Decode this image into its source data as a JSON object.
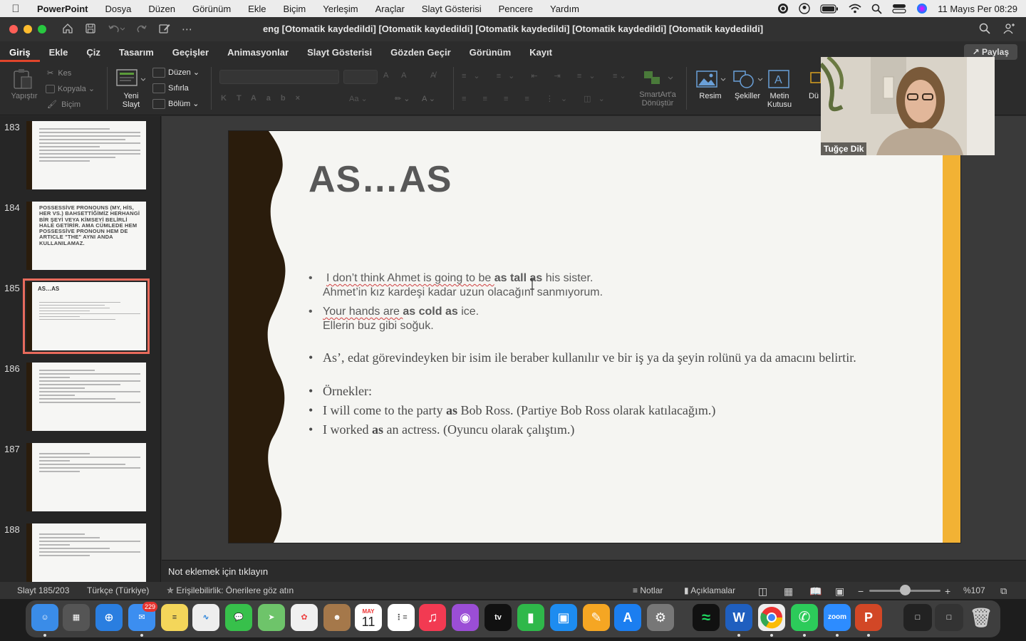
{
  "menubar": {
    "app_name": "PowerPoint",
    "items": [
      "Dosya",
      "Düzen",
      "Görünüm",
      "Ekle",
      "Biçim",
      "Yerleşim",
      "Araçlar",
      "Slayt Gösterisi",
      "Pencere",
      "Yardım"
    ],
    "clock": "11 Mayıs Per  08:29"
  },
  "window": {
    "title": "eng [Otomatik kaydedildi] [Otomatik kaydedildi] [Otomatik kaydedildi] [Otomatik kaydedildi] [Otomatik kaydedildi]"
  },
  "ribbon": {
    "tabs": [
      "Giriş",
      "Ekle",
      "Çiz",
      "Tasarım",
      "Geçişler",
      "Animasyonlar",
      "Slayt Gösterisi",
      "Gözden Geçir",
      "Görünüm",
      "Kayıt"
    ],
    "share_label": "Paylaş",
    "paste_label": "Yapıştır",
    "cut_label": "Kes",
    "copy_label": "Kopyala",
    "format_label": "Biçim",
    "new_slide_label_1": "Yeni",
    "new_slide_label_2": "Slayt",
    "layout_label": "Düzen",
    "reset_label": "Sıfırla",
    "section_label": "Bölüm",
    "smartart_label_1": "SmartArt'a",
    "smartart_label_2": "Dönüştür",
    "picture_label": "Resim",
    "shapes_label": "Şekiller",
    "textbox_label_1": "Metin",
    "textbox_label_2": "Kutusu",
    "arrange_label": "Dü"
  },
  "thumbnails": [
    {
      "number": "183",
      "title": "",
      "text": ""
    },
    {
      "number": "184",
      "title": "",
      "text": "POSSESSİVE PRONOUNS (MY, HİS, HER VS.) BAHSETTİĞİMİZ HERHANGİ BİR ŞEYİ VEYA KİMSEYİ BELİRLİ HALE GETİRİR. AMA CÜMLEDE HEM POSSESSİVE PRONOUN HEM DE ARTICLE \"THE\" AYNI ANDA KULLANILAMAZ."
    },
    {
      "number": "185",
      "title": "AS…AS",
      "text": ""
    },
    {
      "number": "186",
      "title": "",
      "text": ""
    },
    {
      "number": "187",
      "title": "",
      "text": ""
    },
    {
      "number": "188",
      "title": "",
      "text": ""
    }
  ],
  "slide": {
    "title": "AS…AS",
    "bullet1_a": "I don’t think Ahmet is going to be ",
    "bullet1_b": "as tall as",
    "bullet1_c": " his sister.",
    "bullet1_tr": "Ahmet’in kız kardeşi kadar uzun olacağını sanmıyorum.",
    "bullet2_a": "Your hands are ",
    "bullet2_b": "as cold as",
    "bullet2_c": " ice.",
    "bullet2_tr": "Ellerin buz gibi soğuk.",
    "bullet3": "As’, edat görevindeyken bir isim ile beraber kullanılır ve bir iş ya da şeyin rolünü ya da amacını belirtir.",
    "bullet4": "Örnekler:",
    "bullet5_a": "I will come to the party ",
    "bullet5_b": "as",
    "bullet5_c": " Bob Ross. (Partiye Bob Ross olarak katılacağım.)",
    "bullet6_a": "I worked ",
    "bullet6_b": "as",
    "bullet6_c": " an actress. (Oyuncu olarak çalıştım.)",
    "bullet_glyph": "•"
  },
  "camera": {
    "name": "Tuğçe Dik"
  },
  "notes": {
    "placeholder": "Not eklemek için tıklayın"
  },
  "status": {
    "slide_counter": "Slayt 185/203",
    "language": "Türkçe (Türkiye)",
    "accessibility": "Erişilebilirlik: Önerilere göz atın",
    "notes_label": "Notlar",
    "comments_label": "Açıklamalar",
    "zoom": "%107",
    "zoom_fraction": 0.5
  },
  "dock": {
    "mail_badge": "229",
    "calendar_month": "MAY",
    "calendar_day": "11",
    "tv_label": "tv",
    "zoom_label": "zoom"
  }
}
